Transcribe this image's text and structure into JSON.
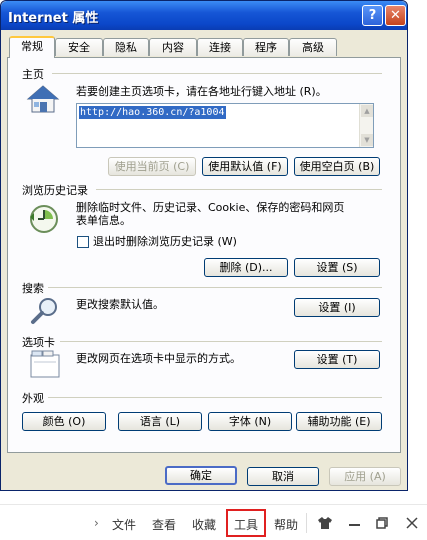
{
  "window": {
    "title": "Internet 属性",
    "help_glyph": "?",
    "close_glyph": "✕"
  },
  "tabs": [
    "常规",
    "安全",
    "隐私",
    "内容",
    "连接",
    "程序",
    "高级"
  ],
  "homepage": {
    "label": "主页",
    "instruction": "若要创建主页选项卡，请在各地址行键入地址 (R)。",
    "url": "http://hao.360.cn/?a1004",
    "buttons": [
      "使用当前页 (C)",
      "使用默认值 (F)",
      "使用空白页 (B)"
    ]
  },
  "history": {
    "label": "浏览历史记录",
    "line1": "删除临时文件、历史记录、Cookie、保存的密码和网页",
    "line2": "表单信息。",
    "checkbox_label": "退出时删除浏览历史记录 (W)",
    "delete_label": "删除 (D)...",
    "settings_label": "设置 (S)"
  },
  "search": {
    "label": "搜索",
    "text": "更改搜索默认值。",
    "settings_label": "设置 (I)"
  },
  "tabsec": {
    "label": "选项卡",
    "text": "更改网页在选项卡中显示的方式。",
    "settings_label": "设置 (T)"
  },
  "appearance": {
    "label": "外观",
    "buttons": [
      "颜色 (O)",
      "语言 (L)",
      "字体 (N)",
      "辅助功能 (E)"
    ]
  },
  "footer": {
    "ok": "确定",
    "cancel": "取消",
    "apply": "应用 (A)"
  },
  "menubar": {
    "chevron": "›",
    "items": [
      "文件",
      "查看",
      "收藏",
      "工具",
      "帮助"
    ],
    "highlighted": "工具",
    "icons": [
      "shirt-icon",
      "minimize-icon",
      "restore-icon",
      "close-icon"
    ]
  }
}
